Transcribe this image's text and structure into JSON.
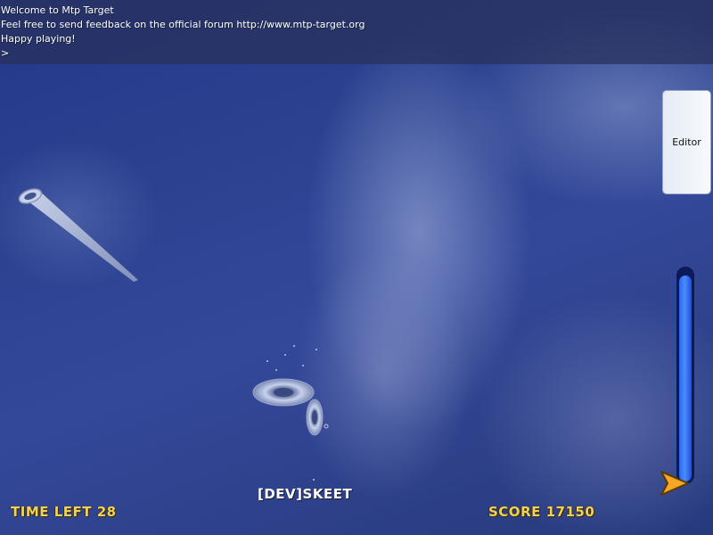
{
  "console": {
    "lines": [
      "Welcome to Mtp Target",
      "Feel free to send feedback on the official forum http://www.mtp-target.org",
      "Happy playing!",
      ">"
    ]
  },
  "editor_button": {
    "label": "Editor"
  },
  "hud": {
    "time_left_label": "TIME LEFT 28",
    "score_label": "SCORE 17150",
    "player_name": "[DEV]SKEET",
    "speed_level": 0.97
  },
  "colors": {
    "hud_yellow": "#f0d25a",
    "bar_blue": "#2b66e8",
    "pointer_orange": "#f5a623"
  }
}
